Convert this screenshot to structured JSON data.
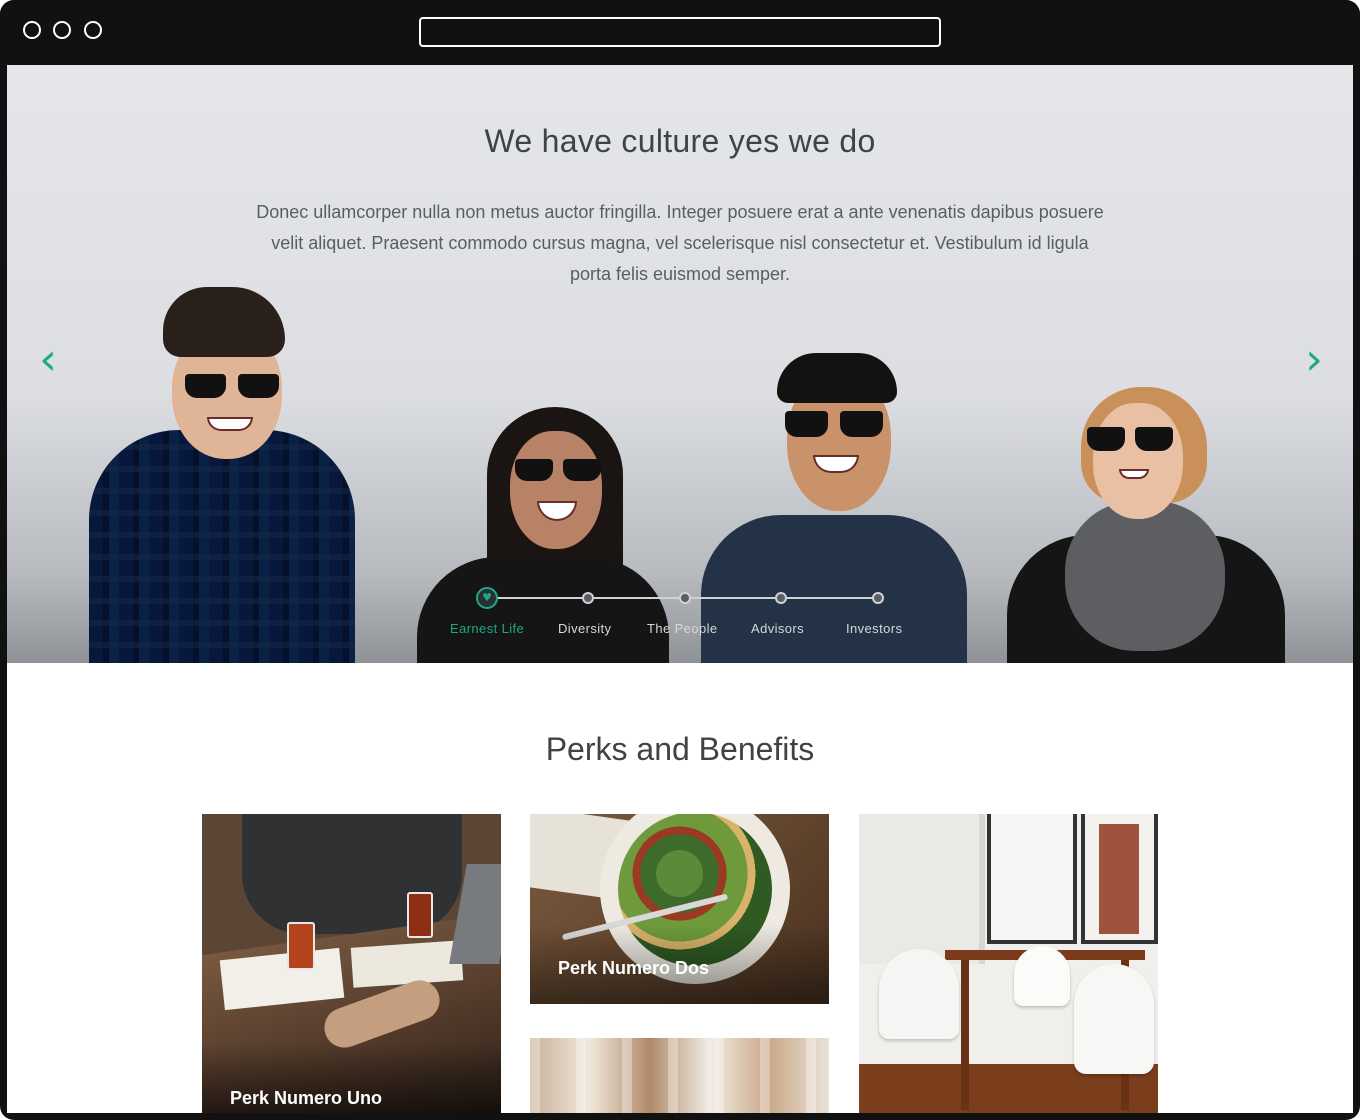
{
  "hero": {
    "title": "We have culture yes we do",
    "text": "Donec ullamcorper nulla non metus auctor fringilla. Integer posuere erat a ante venenatis dapibus posuere velit aliquet. Praesent commodo cursus magna, vel scelerisque nisl consectetur et. Vestibulum id ligula porta felis euismod semper.",
    "prev_icon": "chevron-left-icon",
    "next_icon": "chevron-right-icon",
    "prev_glyph": "‹",
    "next_glyph": "›"
  },
  "timeline": {
    "active_icon": "heart-icon",
    "active_glyph": "♥",
    "items": [
      {
        "label": "Earnest Life"
      },
      {
        "label": "Diversity"
      },
      {
        "label": "The People"
      },
      {
        "label": "Advisors"
      },
      {
        "label": "Investors"
      }
    ]
  },
  "perks": {
    "title": "Perks and Benefits",
    "cards": [
      {
        "label": "Perk Numero Uno"
      },
      {
        "label": "Perk Numero Dos"
      },
      {
        "label": ""
      },
      {
        "label": ""
      }
    ]
  },
  "colors": {
    "accent": "#1fa886",
    "titlebar": "#111111",
    "heading": "#3f4348"
  }
}
